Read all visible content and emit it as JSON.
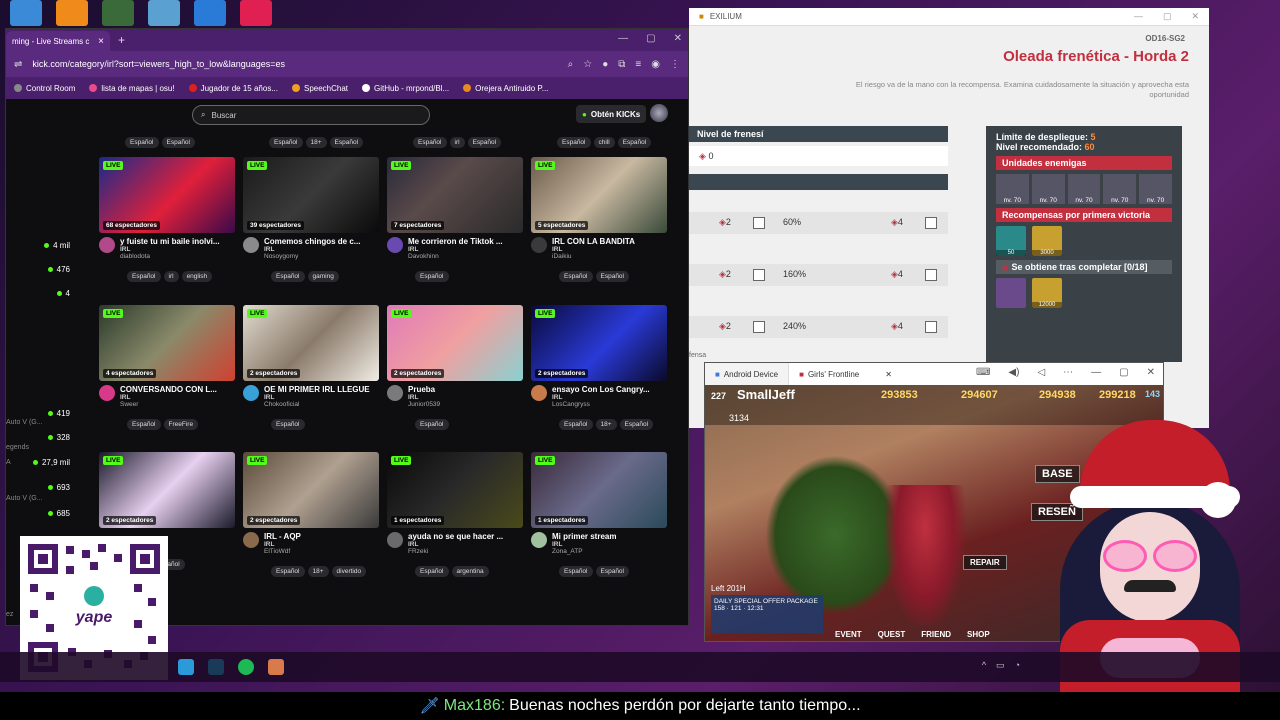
{
  "browser": {
    "tab_title": "ming - Live Streams c",
    "url": "kick.com/category/irl?sort=viewers_high_to_low&languages=es",
    "bookmarks": [
      "Control Room",
      "lista de mapas | osu!",
      "Jugador de 15 años...",
      "SpeechChat",
      "GitHub - mrpond/Bl...",
      "Orejera Antiruido P..."
    ]
  },
  "kick": {
    "search_placeholder": "Buscar",
    "kicks_button": "Obtén KICKs",
    "sidebar_counts": [
      "4 mil",
      "476",
      "4",
      "419",
      "328",
      "27,9 mil",
      "693",
      "685"
    ],
    "sidebar_labels": [
      "Auto V (G...",
      "egends",
      "A",
      "Auto V (G...",
      "ez"
    ],
    "top_tags": [
      [
        "Español",
        "Español"
      ],
      [
        "Español",
        "18+",
        "Español"
      ],
      [
        "Español",
        "irl",
        "Español"
      ],
      [
        "Español",
        "chill",
        "Español"
      ]
    ],
    "streams": [
      {
        "title": "y fuiste tu mi baile inolvi...",
        "category": "IRL",
        "channel": "diablodota",
        "viewers": "68 espectadores",
        "tags": [
          "Español",
          "irl",
          "english"
        ]
      },
      {
        "title": "Comemos chingos de c...",
        "category": "IRL",
        "channel": "Nosoygomy",
        "viewers": "39 espectadores",
        "tags": [
          "Español",
          "gaming"
        ]
      },
      {
        "title": "Me corrieron de Tiktok ...",
        "category": "IRL",
        "channel": "Davokhinn",
        "viewers": "7 espectadores",
        "tags": [
          "Español"
        ]
      },
      {
        "title": "IRL CON LA BANDITA",
        "category": "IRL",
        "channel": "iDaikiu",
        "viewers": "5 espectadores",
        "tags": [
          "Español",
          "Español"
        ]
      },
      {
        "title": "CONVERSANDO CON L...",
        "category": "IRL",
        "channel": "Sweer",
        "viewers": "4 espectadores",
        "tags": [
          "Español",
          "FreeFire"
        ]
      },
      {
        "title": "OE MI PRIMER IRL LLEGUE",
        "category": "IRL",
        "channel": "Chokooficial",
        "viewers": "2 espectadores",
        "tags": [
          "Español"
        ]
      },
      {
        "title": "Prueba",
        "category": "IRL",
        "channel": "Junior0539",
        "viewers": "2 espectadores",
        "tags": [
          "Español"
        ]
      },
      {
        "title": "ensayo Con Los Cangry...",
        "category": "IRL",
        "channel": "LosCangryss",
        "viewers": "2 espectadores",
        "tags": [
          "Español",
          "18+",
          "Español"
        ]
      },
      {
        "title": "",
        "category": "",
        "channel": "",
        "viewers": "2 espectadores",
        "tags": [
          "chill",
          "Español"
        ]
      },
      {
        "title": "IRL - AQP",
        "category": "IRL",
        "channel": "ElTioWdf",
        "viewers": "2 espectadores",
        "tags": [
          "Español",
          "18+",
          "divertido"
        ]
      },
      {
        "title": "ayuda no se que hacer ...",
        "category": "IRL",
        "channel": "FRzeki",
        "viewers": "1 espectadores",
        "tags": [
          "Español",
          "argentina"
        ]
      },
      {
        "title": "Mi primer stream",
        "category": "IRL",
        "channel": "Zona_ATP",
        "viewers": "1 espectadores",
        "tags": [
          "Español",
          "Español"
        ]
      }
    ],
    "live_label": "LIVE"
  },
  "game": {
    "window_title": "EXILIUM",
    "code": "OD16-SG2",
    "heading": "Oleada frenética - Horda 2",
    "description": "El riesgo va de la mano con la recompensa. Examina cuidadosamente la situación y aprovecha esta oportunidad",
    "frenzy_label": "Nivel de frenesí",
    "frenzy_value": "0",
    "rows": [
      {
        "a": "2",
        "pct": "60%",
        "b": "4"
      },
      {
        "a": "2",
        "pct": "160%",
        "b": "4"
      },
      {
        "a": "2",
        "pct": "240%",
        "b": "4"
      }
    ],
    "deploy_limit_label": "Límite de despliegue:",
    "deploy_limit_value": "5",
    "rec_level_label": "Nivel recomendado:",
    "rec_level_value": "60",
    "enemies_label": "Unidades enemigas",
    "enemy_levels": [
      "nv. 70",
      "nv. 70",
      "nv. 70",
      "nv. 70",
      "nv. 70"
    ],
    "first_victory_label": "Recompensas por primera victoria",
    "first_rewards": [
      "50",
      "3000"
    ],
    "after_complete_label": "Se obtiene tras completar [0/18]",
    "after_rewards": [
      "",
      "12000"
    ],
    "footer_text": "fensa"
  },
  "android": {
    "tab1": "Android Device",
    "tab2": "Girls' Frontline",
    "level": "227",
    "player": "SmallJeff",
    "resources": [
      "293853",
      "294607",
      "294938",
      "299218"
    ],
    "res_extra": "143",
    "sub_value": "3134",
    "menu": [
      "BASE",
      "RESEÑ",
      "REPAIR"
    ],
    "bottom": [
      "EVENT",
      "QUEST",
      "FRIEND",
      "SHOP"
    ],
    "timer": "Left 201H",
    "promo": "DAILY SPECIAL OFFER PACKAGE",
    "promo_vals": [
      "158",
      "121",
      "12:31"
    ]
  },
  "chat": {
    "user": "Max186:",
    "message": "Buenas noches perdón por dejarte tanto tiempo..."
  },
  "colors": {
    "kick_green": "#53fc18",
    "game_red": "#c23040",
    "browser_purple": "#5a2a7e"
  }
}
